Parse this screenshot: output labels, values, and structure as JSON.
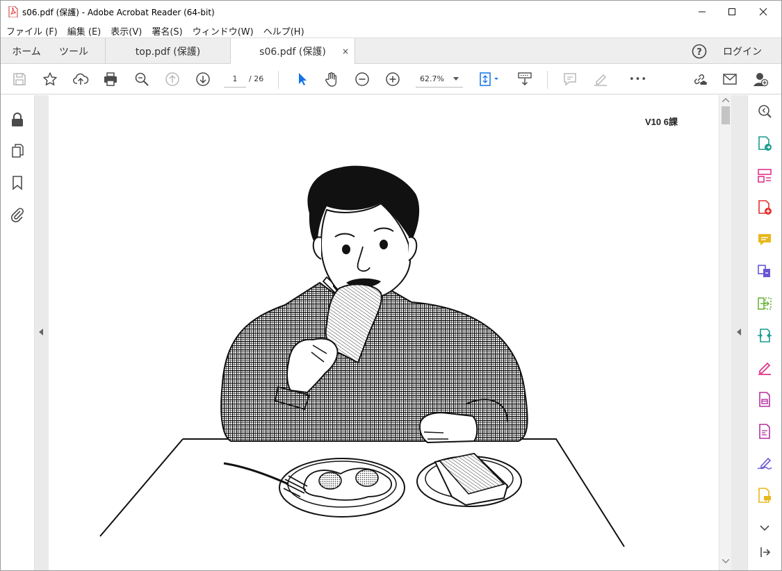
{
  "window": {
    "title": "s06.pdf (保護) - Adobe Acrobat Reader (64-bit)"
  },
  "menu": [
    {
      "label": "ファイル (F)"
    },
    {
      "label": "編集 (E)"
    },
    {
      "label": "表示(V)"
    },
    {
      "label": "署名(S)"
    },
    {
      "label": "ウィンドウ(W)"
    },
    {
      "label": "ヘルプ(H)"
    }
  ],
  "tabs": {
    "home": "ホーム",
    "tools": "ツール",
    "doc1": "top.pdf (保護)",
    "doc2": "s06.pdf (保護)",
    "close_glyph": "×",
    "login": "ログイン",
    "help_glyph": "?"
  },
  "toolbar": {
    "page_current": "1",
    "page_total": "/ 26",
    "zoom": "62.7%",
    "more_glyph": "•••"
  },
  "document": {
    "header": "V10 6課",
    "illustration": "man-eating-toast-illustration"
  },
  "colors": {
    "accent_blue": "#1473e6",
    "icon_grey": "#4b4b4b",
    "disabled_grey": "#b8b8b8",
    "pdf_red": "#e3302f"
  }
}
